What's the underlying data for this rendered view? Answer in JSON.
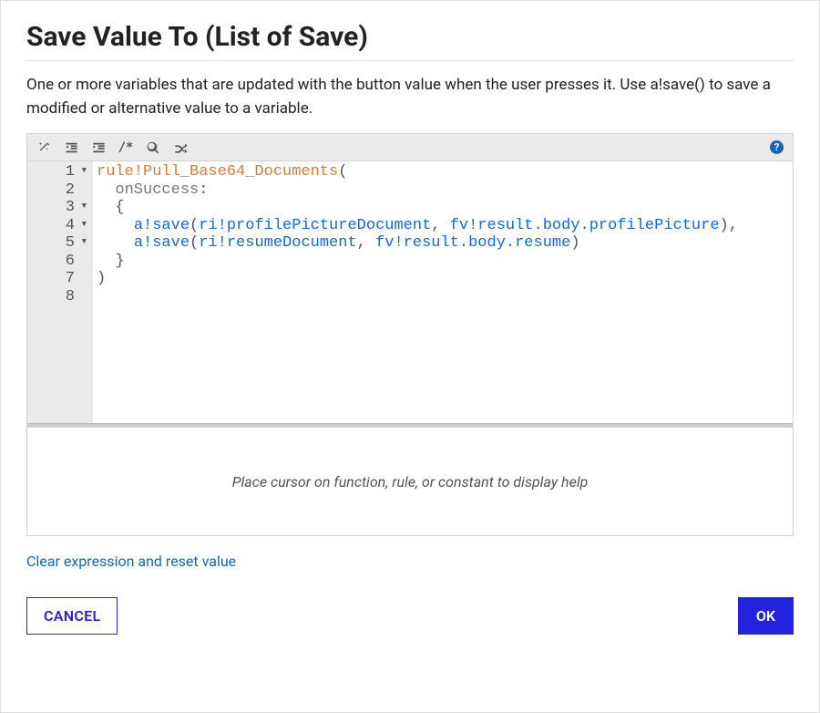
{
  "dialog": {
    "title": "Save Value To (List of Save)",
    "description": "One or more variables that are updated with the button value when the user presses it. Use a!save() to save a modified or alternative value to a variable."
  },
  "toolbar": {
    "help_glyph": "?"
  },
  "editor": {
    "line_numbers": [
      "1",
      "2",
      "3",
      "4",
      "5",
      "6",
      "7",
      "8"
    ],
    "fold_lines": [
      1,
      3,
      4,
      5
    ],
    "code_lines": [
      [
        {
          "cls": "tok-rule",
          "t": "rule!Pull_Base64_Documents"
        },
        {
          "cls": "tok-punc",
          "t": "("
        }
      ],
      [
        {
          "cls": "",
          "t": "  "
        },
        {
          "cls": "tok-kw",
          "t": "onSuccess"
        },
        {
          "cls": "tok-punc",
          "t": ":"
        }
      ],
      [
        {
          "cls": "",
          "t": "  "
        },
        {
          "cls": "tok-punc",
          "t": "{"
        }
      ],
      [
        {
          "cls": "",
          "t": "    "
        },
        {
          "cls": "tok-fn",
          "t": "a!save"
        },
        {
          "cls": "tok-punc",
          "t": "("
        },
        {
          "cls": "tok-var",
          "t": "ri!profilePictureDocument"
        },
        {
          "cls": "tok-punc",
          "t": ", "
        },
        {
          "cls": "tok-var",
          "t": "fv!result.body.profilePicture"
        },
        {
          "cls": "tok-punc",
          "t": "),"
        }
      ],
      [
        {
          "cls": "",
          "t": "    "
        },
        {
          "cls": "tok-fn",
          "t": "a!save"
        },
        {
          "cls": "tok-punc",
          "t": "("
        },
        {
          "cls": "tok-var",
          "t": "ri!resumeDocument"
        },
        {
          "cls": "tok-punc",
          "t": ", "
        },
        {
          "cls": "tok-var",
          "t": "fv!result.body.resume"
        },
        {
          "cls": "tok-punc",
          "t": ")"
        }
      ],
      [
        {
          "cls": "",
          "t": "  "
        },
        {
          "cls": "tok-punc",
          "t": "}"
        }
      ],
      [
        {
          "cls": "tok-punc",
          "t": ")"
        }
      ],
      [
        {
          "cls": "",
          "t": ""
        }
      ]
    ]
  },
  "help_hint": "Place cursor on function, rule, or constant to display help",
  "clear_link": "Clear expression and reset value",
  "buttons": {
    "cancel": "CANCEL",
    "ok": "OK"
  }
}
